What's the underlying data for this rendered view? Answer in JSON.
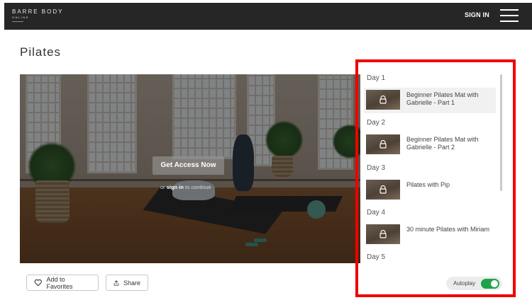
{
  "header": {
    "logo_line1": "BARRE BODY",
    "logo_line2": "ONLINE",
    "signin_label": "SIGN IN",
    "menu_icon": "hamburger-menu-icon"
  },
  "page": {
    "title": "Pilates"
  },
  "video": {
    "cta_label": "Get Access Now",
    "signin_prefix": "or",
    "signin_link": "sign in",
    "signin_suffix": "to continue"
  },
  "actions": {
    "favorites_label": "Add to Favorites",
    "favorites_icon": "heart-icon",
    "share_label": "Share",
    "share_icon": "share-icon"
  },
  "playlist": {
    "items": [
      {
        "day": "Day 1",
        "title": "Beginner Pilates Mat with Gabrielle - Part 1",
        "locked": true,
        "active": true
      },
      {
        "day": "Day 2",
        "title": "Beginner Pilates Mat with Gabrielle - Part 2",
        "locked": true,
        "active": false
      },
      {
        "day": "Day 3",
        "title": "Pilates with Pip",
        "locked": true,
        "active": false
      },
      {
        "day": "Day 4",
        "title": "30 minute Pilates with Miriam",
        "locked": true,
        "active": false
      },
      {
        "day": "Day 5",
        "title": "",
        "locked": true,
        "active": false
      }
    ]
  },
  "autoplay": {
    "label": "Autoplay",
    "enabled": true
  },
  "colors": {
    "nav_bg": "#262626",
    "toggle_on": "#1fa34a",
    "highlight_border": "#ee0000"
  }
}
